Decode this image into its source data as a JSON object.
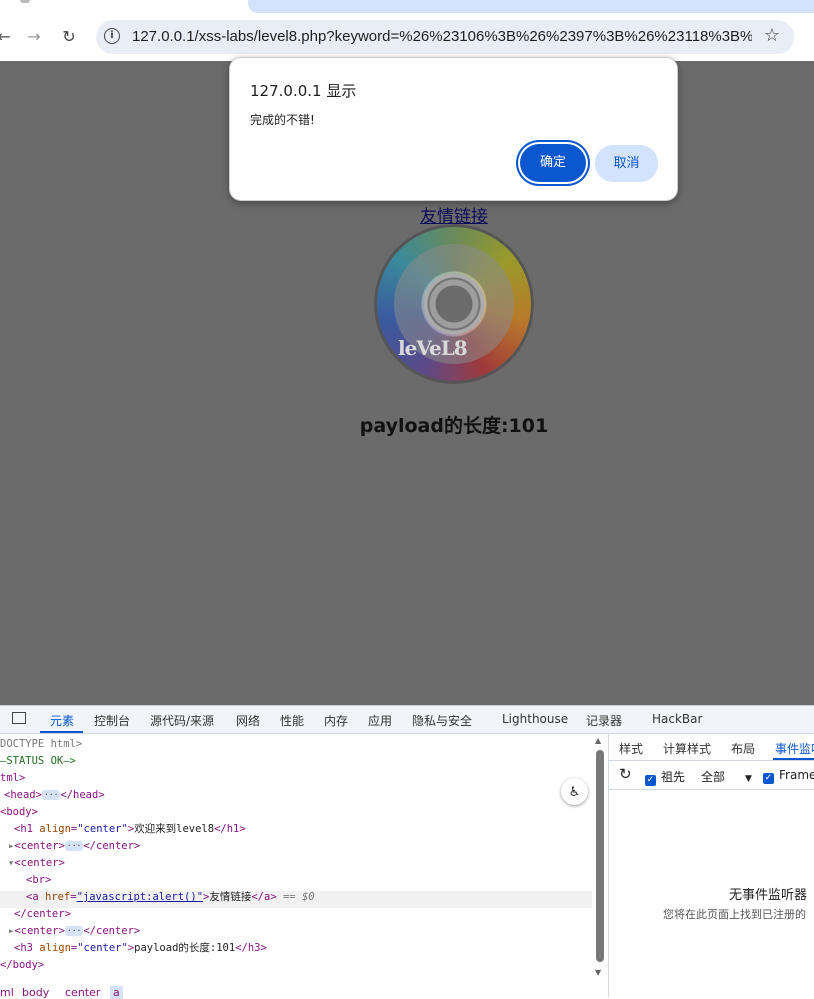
{
  "browser": {
    "url": "127.0.0.1/xss-labs/level8.php?keyword=%26%23106%3B%26%2397%3B%26%23118%3B%...",
    "back_icon": "arrow-left-icon",
    "forward_icon": "arrow-right-icon",
    "reload_icon": "reload-icon",
    "info_icon": "info-icon",
    "bookmark_icon": "star-icon"
  },
  "page": {
    "link_text": "友情链接",
    "image_text": "leVeL8",
    "payload_text": "payload的长度:101"
  },
  "dialog": {
    "title": "127.0.0.1 显示",
    "message": "完成的不错!",
    "ok_label": "确定",
    "cancel_label": "取消"
  },
  "devtools": {
    "tabs": [
      "元素",
      "控制台",
      "源代码/来源",
      "网络",
      "性能",
      "内存",
      "应用",
      "隐私与安全",
      "Lighthouse",
      "记录器",
      "HackBar"
    ],
    "active_tab": "元素",
    "dom_lines": {
      "l1": "DOCTYPE html>",
      "l2": "—STATUS OK—>",
      "l3": "tml>",
      "l4_open": "<head>",
      "l4_close": "</head>",
      "l5": "<body>",
      "l6_tag": "<h1 ",
      "l6_attr": "align",
      "l6_val": "\"center\"",
      "l6_text": "欢迎来到level8",
      "l6_close": "</h1>",
      "l7_open": "<center>",
      "l7_close": "</center>",
      "l8": "<center>",
      "l9": "<br>",
      "l10_tag": "<a ",
      "l10_attr": "href",
      "l10_val": "\"javascript:alert()\"",
      "l10_text": "友情链接",
      "l10_close": "</a>",
      "l10_marker": "== $0",
      "l11": "</center>",
      "l12_open": "<center>",
      "l12_close": "</center>",
      "l13_tag": "<h3 ",
      "l13_attr": "align",
      "l13_val": "\"center\"",
      "l13_text": "payload的长度:101",
      "l13_close": "</h3>",
      "l14": "</body>"
    },
    "breadcrumbs": [
      "ml",
      "body",
      "center",
      "a"
    ],
    "side_tabs": [
      "样式",
      "计算样式",
      "布局",
      "事件监听"
    ],
    "side_active": "事件监听",
    "filters": {
      "ancestors_label": "祖先",
      "scope_label": "全部",
      "framework_label": "Frame"
    },
    "empty_title": "无事件监听器",
    "empty_desc": "您将在此页面上找到已注册的"
  },
  "colors": {
    "accent": "#0b57d0",
    "page_overlay": "#6b6b6b"
  }
}
